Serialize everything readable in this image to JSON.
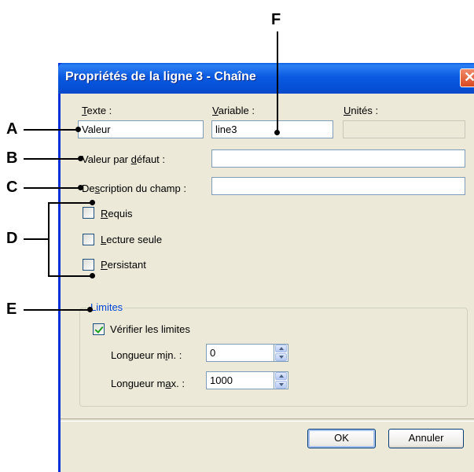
{
  "dialog": {
    "title": "Propriétés de la ligne 3 - Chaîne",
    "close_glyph": "✕"
  },
  "fields": {
    "texte_label": "Texte :",
    "texte_value": "Valeur",
    "variable_label": "Variable :",
    "variable_value": "line3",
    "unites_label": "Unités :",
    "unites_value": "",
    "default_label": "Valeur par défaut :",
    "default_value": "",
    "description_label": "Description du champ :",
    "description_value": ""
  },
  "checkboxes": {
    "requis": {
      "label": "Requis",
      "checked": false
    },
    "lecture_seule": {
      "label": "Lecture seule",
      "checked": false
    },
    "persistant": {
      "label": "Persistant",
      "checked": false
    }
  },
  "limits": {
    "group_title": "Limites",
    "check_label": "Vérifier les limites",
    "check_checked": true,
    "min_label": "Longueur min. :",
    "min_value": "0",
    "max_label": "Longueur max. :",
    "max_value": "1000"
  },
  "buttons": {
    "ok": "OK",
    "cancel": "Annuler"
  },
  "callouts": {
    "a": "A",
    "b": "B",
    "c": "C",
    "d": "D",
    "e": "E",
    "f": "F"
  },
  "colors": {
    "titlebar": "#0a5fe3",
    "dialog_bg": "#ece9d8",
    "group_title": "#0046d5"
  }
}
